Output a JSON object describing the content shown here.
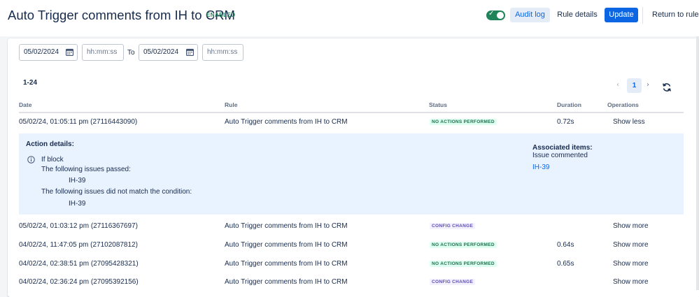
{
  "header": {
    "title": "Auto Trigger comments from IH to CRM",
    "status_badge": "ENABLED",
    "toggle_checked": true,
    "buttons": {
      "audit_log": "Audit log",
      "rule_details": "Rule details",
      "update": "Update",
      "return": "Return to rules"
    }
  },
  "filters": {
    "from_date": "05/02/2024",
    "from_time_placeholder": "hh:mm:ss",
    "to_label": "To",
    "to_date": "05/02/2024",
    "to_time_placeholder": "hh:mm:ss"
  },
  "results": {
    "range": "1-24",
    "current_page": "1"
  },
  "table": {
    "columns": [
      "Date",
      "Rule",
      "Status",
      "Duration",
      "Operations"
    ],
    "rows": [
      {
        "date": "05/02/24, 01:05:11 pm (27116443090)",
        "rule": "Auto Trigger comments from IH to CRM",
        "status": "NO ACTIONS PERFORMED",
        "duration": "0.72s",
        "operation": "Show less"
      },
      {
        "date": "05/02/24, 01:03:12 pm (27116367697)",
        "rule": "Auto Trigger comments from IH to CRM",
        "status": "CONFIG CHANGE",
        "duration": "",
        "operation": "Show more"
      },
      {
        "date": "04/02/24, 11:47:05 pm (27102087812)",
        "rule": "Auto Trigger comments from IH to CRM",
        "status": "NO ACTIONS PERFORMED",
        "duration": "0.64s",
        "operation": "Show more"
      },
      {
        "date": "04/02/24, 02:38:51 pm (27095428321)",
        "rule": "Auto Trigger comments from IH to CRM",
        "status": "NO ACTIONS PERFORMED",
        "duration": "0.65s",
        "operation": "Show more"
      },
      {
        "date": "04/02/24, 02:36:24 pm (27095392156)",
        "rule": "Auto Trigger comments from IH to CRM",
        "status": "CONFIG CHANGE",
        "duration": "",
        "operation": "Show more"
      }
    ]
  },
  "details": {
    "title": "Action details:",
    "block": "If block",
    "passed_label": "The following issues passed:",
    "passed_issue": "IH-39",
    "failed_label": "The following issues did not match the condition:",
    "failed_issue": "IH-39",
    "associated_title": "Associated items:",
    "associated_type": "Issue commented",
    "associated_issue": "IH-39"
  },
  "colors": {
    "primary": "#0c66e4",
    "success": "#1f845a",
    "discovery": "#5e4db2",
    "details_bg": "#e9f2ff"
  }
}
